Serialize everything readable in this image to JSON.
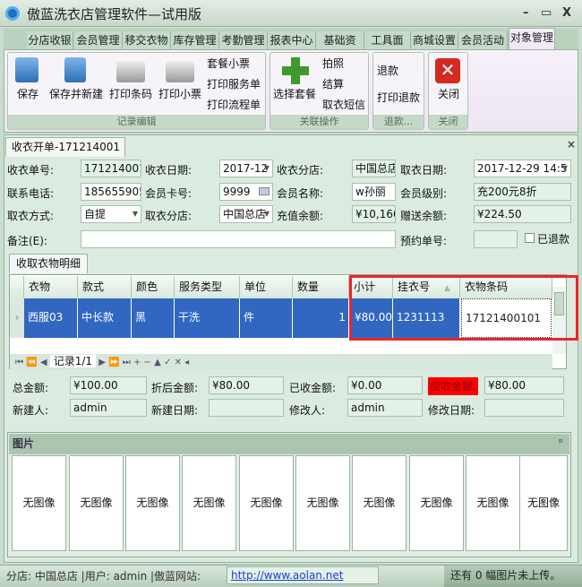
{
  "window": {
    "title": "傲蓝洗衣店管理软件—试用版",
    "min": "–",
    "max": "▭",
    "close": "X"
  },
  "menu_tabs": [
    "分店收银",
    "会员管理",
    "移交衣物",
    "库存管理",
    "考勤管理",
    "报表中心",
    "基础资",
    "工具面",
    "商城设置",
    "会员活动",
    "对象管理"
  ],
  "active_tab": "对象管理",
  "ribbon": {
    "record_edit": {
      "label": "记录编辑",
      "save": "保存",
      "save_new": "保存并新建",
      "print_barcode": "打印条码",
      "print_receipt": "打印小票",
      "package_receipt": "套餐小票",
      "print_service": "打印服务单",
      "print_flow": "打印流程单"
    },
    "related": {
      "label": "关联操作",
      "select_package": "选择套餐",
      "photo": "拍照",
      "settle": "结算",
      "pickup_sms": "取衣短信"
    },
    "refund": {
      "label": "退款...",
      "refund": "退款",
      "print_refund": "打印退款"
    },
    "close": {
      "label": "关闭",
      "close": "关闭"
    }
  },
  "doc_tab": "收衣开单-171214001",
  "form": {
    "order_no_label": "收衣单号:",
    "order_no": "171214001",
    "recv_date_label": "收衣日期:",
    "recv_date": "2017-12",
    "recv_store_label": "收衣分店:",
    "recv_store": "中国总店",
    "pickup_date_label": "取衣日期:",
    "pickup_date": "2017-12-29 14:5",
    "phone_label": "联系电话:",
    "phone": "185655905",
    "card_label": "会员卡号:",
    "card": "9999",
    "member_name_label": "会员名称:",
    "member_name": "w孙丽",
    "member_level_label": "会员级别:",
    "member_level": "充200元8折",
    "pickup_method_label": "取衣方式:",
    "pickup_method": "自提",
    "pickup_store_label": "取衣分店:",
    "pickup_store": "中国总店",
    "recharge_label": "充值余额:",
    "recharge": "¥10,160",
    "gift_label": "赠送余额:",
    "gift": "¥224.50",
    "note_label": "备注(E):",
    "note": "",
    "reserve_label": "预约单号:",
    "reserve": "",
    "refunded_label": "已退款",
    "refunded": false
  },
  "detail_tab": "收取衣物明细",
  "grid": {
    "columns": [
      "衣物",
      "款式",
      "颜色",
      "服务类型",
      "单位",
      "数量",
      "小计",
      "挂衣号",
      "衣物条码"
    ],
    "rows": [
      [
        "西服03",
        "中长款",
        "黑",
        "干洗",
        "件",
        "1",
        "¥80.00",
        "1231113",
        "17121400101"
      ]
    ],
    "nav_record": "记录1/1"
  },
  "totals": {
    "total_label": "总金额:",
    "total": "¥100.00",
    "discount_label": "折后金额:",
    "discount": "¥80.00",
    "received_label": "已收金额:",
    "received": "¥0.00",
    "due_label": "应收金额:",
    "due": "¥80.00",
    "creator_label": "新建人:",
    "creator": "admin",
    "created_label": "新建日期:",
    "created": "",
    "modifier_label": "修改人:",
    "modifier": "admin",
    "modified_label": "修改日期:",
    "modified": ""
  },
  "pictures": {
    "title": "图片",
    "pin": "ᵖ",
    "items": [
      "无图像",
      "无图像",
      "无图像",
      "无图像",
      "无图像",
      "无图像",
      "无图像",
      "无图像",
      "无图像",
      "无图像"
    ]
  },
  "status": {
    "info": "分店: 中国总店 |用户: admin |傲蓝网站:",
    "url": "http://www.aolan.net",
    "upload": "还有 0 幅图片未上传。"
  },
  "colors": {
    "selection": "#3267c1",
    "highlight_box": "#e8262b",
    "due_label_bg": "#ff0000"
  }
}
